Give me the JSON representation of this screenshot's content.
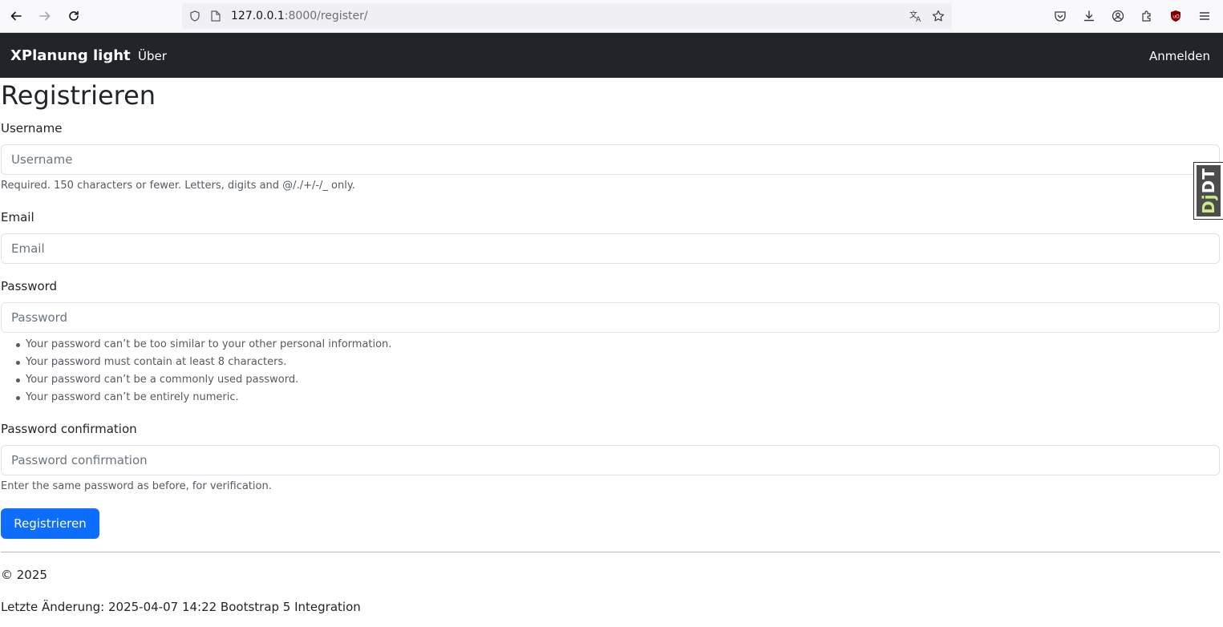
{
  "browser": {
    "url_host": "127.0.0.1",
    "url_rest": ":8000/register/"
  },
  "navbar": {
    "brand": "XPlanung light",
    "about_link": "Über",
    "login_link": "Anmelden"
  },
  "page": {
    "title": "Registrieren"
  },
  "form": {
    "username": {
      "label": "Username",
      "placeholder": "Username",
      "value": "",
      "help": "Required. 150 characters or fewer. Letters, digits and @/./+/-/_ only."
    },
    "email": {
      "label": "Email",
      "placeholder": "Email",
      "value": ""
    },
    "password": {
      "label": "Password",
      "placeholder": "Password",
      "value": "",
      "help": [
        "Your password can’t be too similar to your other personal information.",
        "Your password must contain at least 8 characters.",
        "Your password can’t be a commonly used password.",
        "Your password can’t be entirely numeric."
      ]
    },
    "password_confirmation": {
      "label": "Password confirmation",
      "placeholder": "Password confirmation",
      "value": "",
      "help": "Enter the same password as before, for verification."
    },
    "submit_label": "Registrieren"
  },
  "footer": {
    "copyright": "© 2025",
    "last_change": "Letzte Änderung: 2025-04-07 14:22 Bootstrap 5 Integration"
  },
  "debug_toolbar": {
    "handle_prefix": "Dj",
    "handle_suffix": "DT"
  },
  "colors": {
    "navbar_bg": "#212529",
    "primary": "#0d6efd"
  }
}
